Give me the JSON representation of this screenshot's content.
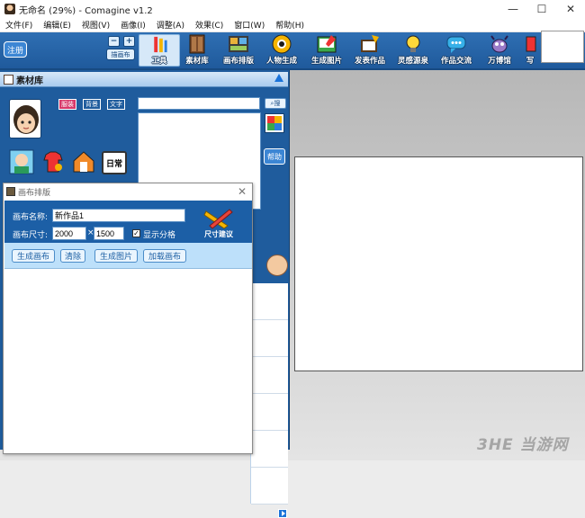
{
  "window": {
    "title": "无命名 (29%) - Comagine v1.2",
    "minimize": "—",
    "maximize": "☐",
    "close": "✕"
  },
  "menu": [
    "文件(F)",
    "编辑(E)",
    "视图(V)",
    "画像(I)",
    "调整(A)",
    "效果(C)",
    "窗口(W)",
    "帮助(H)"
  ],
  "toolbar": {
    "register": "注册",
    "mini_minus": "−",
    "mini_plus": "+",
    "mini_label": "描画布",
    "tools": [
      {
        "label": "工具",
        "icon": "pen-tool-icon"
      },
      {
        "label": "素材库",
        "icon": "cabinet-icon"
      },
      {
        "label": "画布排版",
        "icon": "layout-icon"
      },
      {
        "label": "人物生成",
        "icon": "eye-icon"
      },
      {
        "label": "生成图片",
        "icon": "picture-icon"
      },
      {
        "label": "发表作品",
        "icon": "publish-icon"
      },
      {
        "label": "灵感源泉",
        "icon": "lightbulb-icon"
      },
      {
        "label": "作品交流",
        "icon": "chat-icon"
      },
      {
        "label": "万博馆",
        "icon": "bug-icon"
      },
      {
        "label": "写",
        "icon": "write-icon"
      }
    ]
  },
  "material": {
    "title": "素材库",
    "categories": [
      "服装",
      "背景",
      "文字"
    ],
    "search_value": "",
    "search_button": "搜",
    "help_button": "帮助",
    "daily_label": "日常"
  },
  "dialog": {
    "title": "画布排版",
    "name_label": "画布名称:",
    "name_value": "新作品1",
    "size_label": "画布尺寸:",
    "width": "2000",
    "times": "×",
    "height": "1500",
    "show_grid": "显示分格",
    "grid_checked": "✓",
    "size_suggest": "尺寸建议",
    "buttons": [
      "生成画布",
      "清除",
      "生成图片",
      "加载画布"
    ]
  },
  "watermark": "3HE 当游网"
}
